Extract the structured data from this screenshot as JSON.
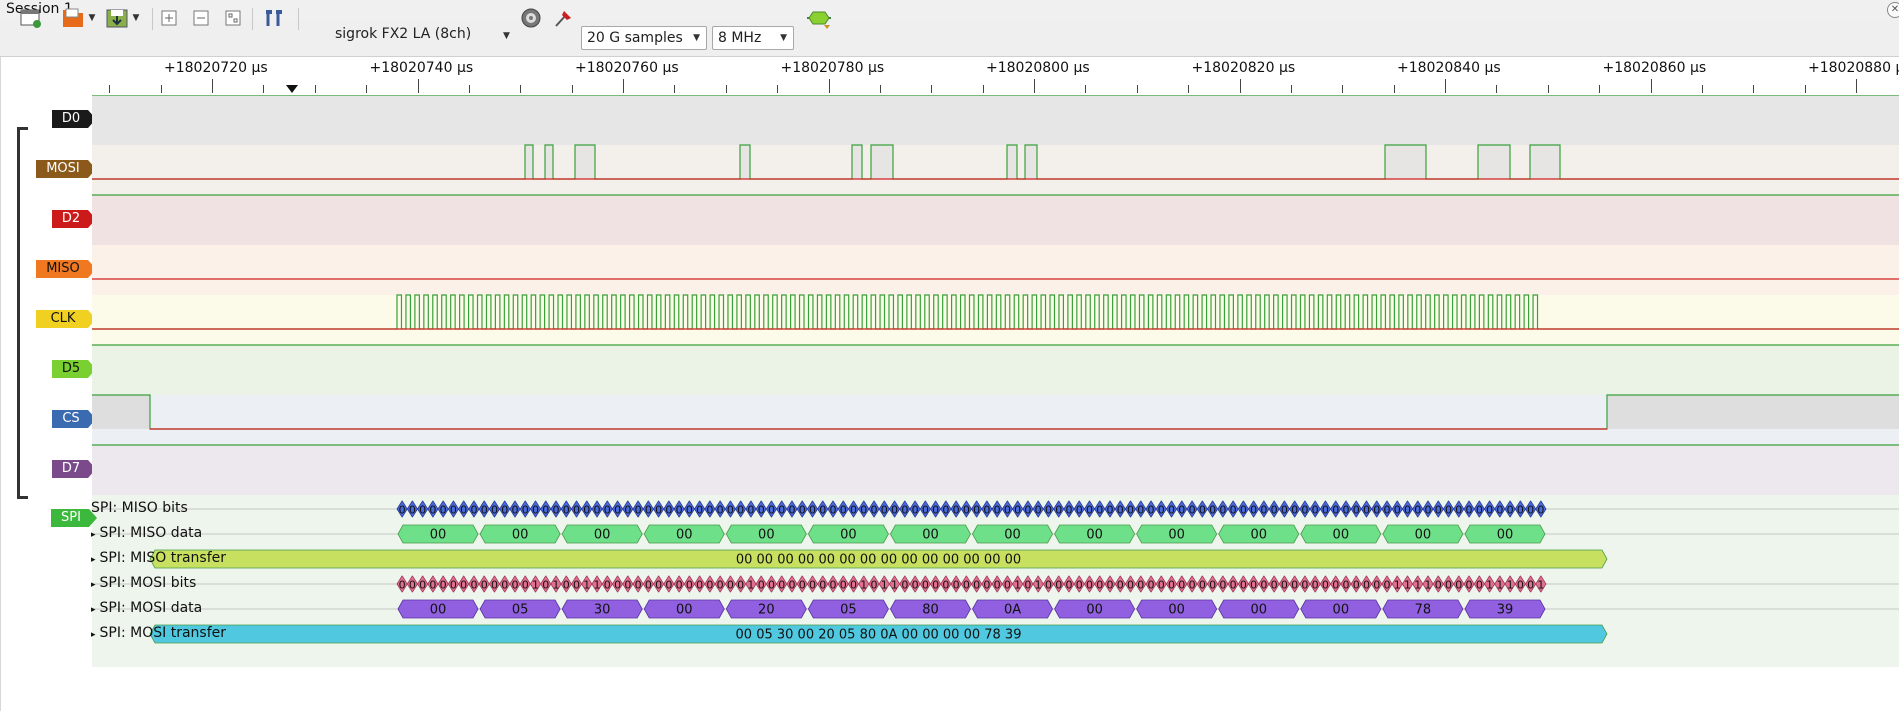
{
  "window": {
    "title": "Session 1"
  },
  "toolbar": {
    "device": "sigrok FX2 LA (8ch)",
    "samples": "20 G samples",
    "samplerate": "8 MHz",
    "icons": [
      "new-session-icon",
      "open-file-icon",
      "save-icon",
      "zoom-in-icon",
      "zoom-out-icon",
      "zoom-fit-icon",
      "cursor-icon",
      "device-config-icon",
      "probe-icon",
      "run-icon"
    ]
  },
  "ruler": {
    "labels": [
      "+18020720 µs",
      "+18020740 µs",
      "+18020760 µs",
      "+18020780 µs",
      "+18020800 µs",
      "+18020820 µs",
      "+18020840 µs",
      "+18020860 µs",
      "+18020880 µs"
    ]
  },
  "channels": [
    {
      "name": "D0",
      "color": "#1a1a1a"
    },
    {
      "name": "MOSI",
      "color": "#8b5a1a"
    },
    {
      "name": "D2",
      "color": "#cc1a1a"
    },
    {
      "name": "MISO",
      "color": "#f07820"
    },
    {
      "name": "CLK",
      "color": "#f0d020"
    },
    {
      "name": "D5",
      "color": "#7ad030"
    },
    {
      "name": "CS",
      "color": "#3a6ab0"
    },
    {
      "name": "D7",
      "color": "#7a4a8a"
    }
  ],
  "decoder": {
    "name": "SPI",
    "color": "#3cb83c",
    "rows": [
      {
        "label": "SPI: MISO bits",
        "type": "bits",
        "color": "#4a6ad8"
      },
      {
        "label": "SPI: MISO data",
        "type": "bytes",
        "color": "#6ee08a",
        "values": [
          "00",
          "00",
          "00",
          "00",
          "00",
          "00",
          "00",
          "00",
          "00",
          "00",
          "00",
          "00",
          "00",
          "00"
        ]
      },
      {
        "label": "SPI: MISO transfer",
        "type": "transfer",
        "color": "#c8e060",
        "text": "00 00 00 00 00 00 00 00 00 00 00 00 00 00"
      },
      {
        "label": "SPI: MOSI bits",
        "type": "bits",
        "color": "#e07090"
      },
      {
        "label": "SPI: MOSI data",
        "type": "bytes",
        "color": "#9060e0",
        "values": [
          "00",
          "05",
          "30",
          "00",
          "20",
          "05",
          "80",
          "0A",
          "00",
          "00",
          "00",
          "00",
          "78",
          "39"
        ]
      },
      {
        "label": "SPI: MOSI transfer",
        "type": "transfer",
        "color": "#50c8e0",
        "text": "00 05 30 00 20 05 80 0A 00 00 00 00 78 39"
      }
    ]
  }
}
